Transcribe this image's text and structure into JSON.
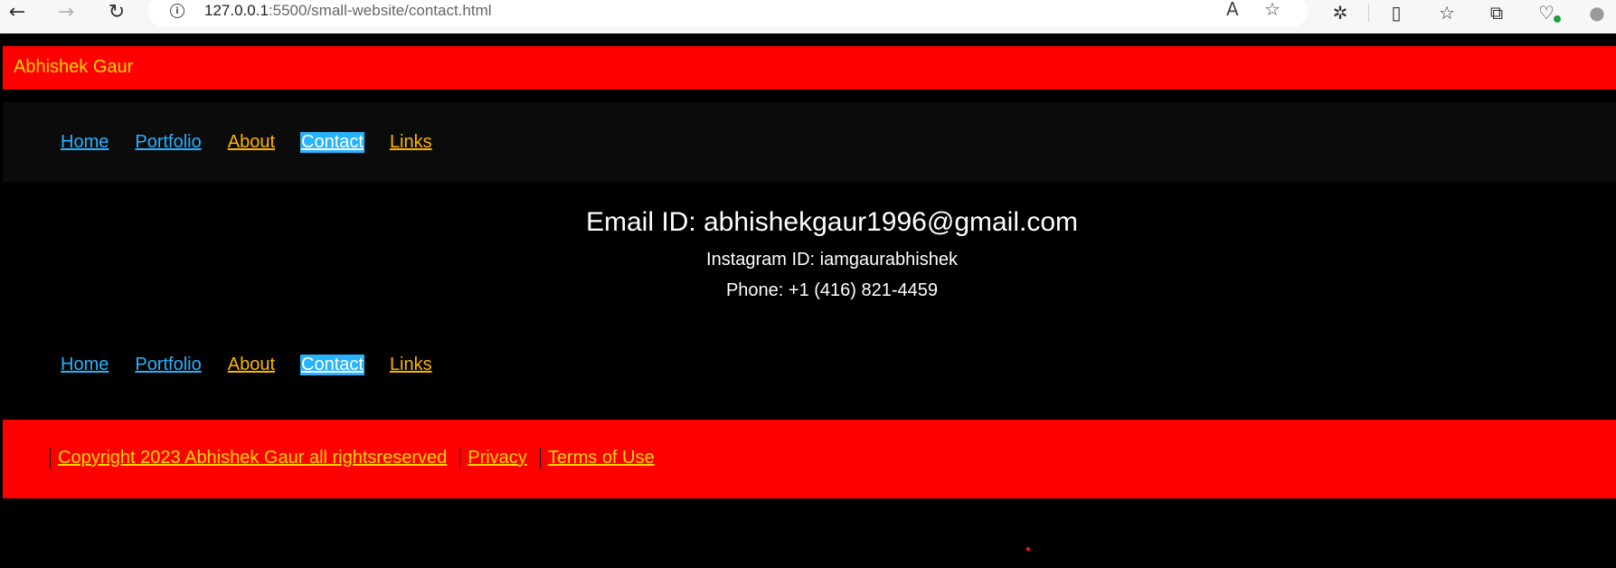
{
  "browser": {
    "url_host": "127.0.0.1",
    "url_rest": ":5500/small-website/contact.html",
    "icons": {
      "back": "←",
      "forward": "→",
      "reload": "↻",
      "info": "i",
      "read_aloud": "A",
      "favorite": "☆",
      "extensions": "✲",
      "split_screen": "▯",
      "favorites_bar": "☆",
      "collections": "⧉",
      "health": "♡",
      "profile": "●"
    }
  },
  "site": {
    "title": "Abhishek Gaur"
  },
  "nav": {
    "items": [
      {
        "label": "Home",
        "color": "#26b3ff"
      },
      {
        "label": "Portfolio",
        "color": "#26b3ff"
      },
      {
        "label": "About",
        "color": "#ffb400"
      },
      {
        "label": "Contact",
        "color": "#ffffff",
        "active": true
      },
      {
        "label": "Links",
        "color": "#ffb400"
      }
    ]
  },
  "contact": {
    "email": "Email ID: abhishekgaur1996@gmail.com",
    "instagram": "Instagram ID: iamgaurabhishek",
    "phone": "Phone: +1 (416) 821-4459"
  },
  "footer": {
    "copyright": "Copyright 2023 Abhishek Gaur all rightsreserved",
    "privacy": "Privacy",
    "terms": "Terms of Use"
  },
  "colors": {
    "header_bg": "#ff0000",
    "page_bg": "#000000",
    "nav_bg": "#0b0b0b",
    "title_text": "#ffd700",
    "link_blue": "#26b3ff",
    "link_gold": "#ffb400"
  }
}
